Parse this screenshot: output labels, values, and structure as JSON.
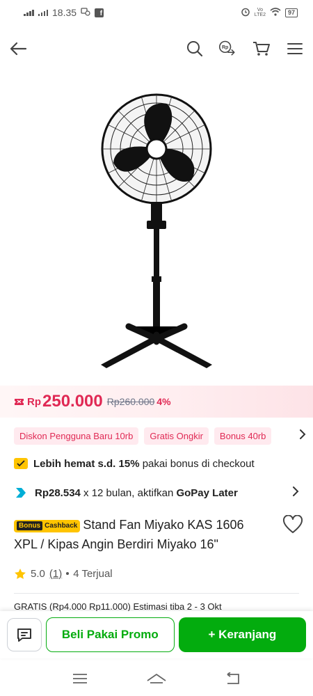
{
  "status_bar": {
    "time": "18.35",
    "battery": "97",
    "network_label": "LTE2"
  },
  "header": {
    "rp_label": "Rp"
  },
  "price": {
    "currency": "Rp",
    "current": "250.000",
    "original": "Rp260.000",
    "discount": "4%"
  },
  "promos": [
    "Diskon Pengguna Baru 10rb",
    "Gratis Ongkir",
    "Bonus 40rb"
  ],
  "hemat": {
    "bold": "Lebih hemat s.d. 15%",
    "rest": " pakai bonus di checkout"
  },
  "gopay": {
    "amount": "Rp28.534",
    "middle": " x 12 bulan, aktifkan ",
    "brand": "GoPay Later"
  },
  "product": {
    "badge_part1": "Bonus",
    "badge_part2": "Cashback",
    "title": "Stand Fan Miyako KAS 1606 XPL / Kipas Angin Berdiri Miyako 16\""
  },
  "rating": {
    "score": "5.0",
    "count": "(1)",
    "sold": "4 Terjual"
  },
  "ongkir_peek": "GRATIS  (Rp4.000 Rp11.000) Estimasi tiba 2 - 3 Okt",
  "bottom": {
    "promo_button": "Beli Pakai Promo",
    "cart_button": "+ Keranjang"
  },
  "colors": {
    "accent_green": "#03ac0e",
    "price_red": "#e02954",
    "bonus_yellow": "#ffc400"
  }
}
